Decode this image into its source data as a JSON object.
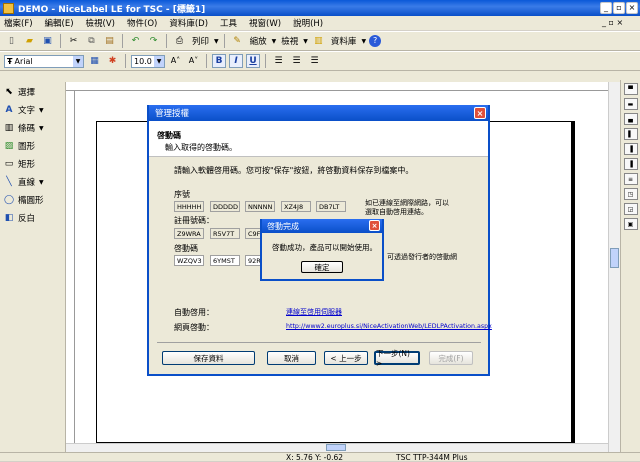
{
  "window": {
    "title": "DEMO - NiceLabel LE for TSC - [標籤1]"
  },
  "menu": [
    "檔案(F)",
    "編輯(E)",
    "檢視(V)",
    "物件(O)",
    "資料庫(D)",
    "工具",
    "視窗(W)",
    "說明(H)"
  ],
  "toolbar1": {
    "print": "列印",
    "zoom": "縮放",
    "check": "檢視",
    "database": "資料庫"
  },
  "toolbar2": {
    "font": "Arial",
    "size": "10.0",
    "bold": "B",
    "italic": "I",
    "underline": "U"
  },
  "tools": [
    {
      "label": "選擇",
      "icon": "pointer-icon"
    },
    {
      "label": "文字",
      "icon": "text-icon"
    },
    {
      "label": "條碼",
      "icon": "barcode-icon"
    },
    {
      "label": "圖形",
      "icon": "picture-icon"
    },
    {
      "label": "矩形",
      "icon": "rectangle-icon"
    },
    {
      "label": "直線",
      "icon": "line-icon"
    },
    {
      "label": "橢圓形",
      "icon": "ellipse-icon"
    },
    {
      "label": "反白",
      "icon": "inverse-icon"
    }
  ],
  "dialog": {
    "title": "管理授權",
    "header_title": "啓動碼",
    "header_sub": "輸入取得的啓動碼。",
    "instruction": "請輸入軟體啓用碼。您可按\"保存\"按鈕，將啓動資料保存到檔案中。",
    "serial_label": "序號",
    "serial": [
      "HHHHH",
      "DDDDD",
      "NNNNN",
      "XZ4J8",
      "DB7LT"
    ],
    "reg_label": "註冊號碼：",
    "reg": [
      "Z9WRA",
      "R5V7T",
      "C9FX"
    ],
    "act_label": "啓動碼",
    "act": [
      "WZQV3",
      "6YMST",
      "92RS"
    ],
    "right_text1": "如已連線至網際網路，可以",
    "right_text2": "選取自動啓用連結。",
    "right_text3": "可透過發行者的啓動網",
    "right_text4": "。",
    "auto_label": "自動啓用：",
    "auto_link": "連線至啓用伺服器",
    "web_label": "網頁啓動：",
    "web_link": "http://www2.europlus.si/NiceActivationWeb/LEDLPActivation.aspx",
    "btn_save": "保存資料",
    "btn_cancel": "取消",
    "btn_prev": "< 上一步",
    "btn_next": "下一步(N) >",
    "btn_finish": "完成(F)"
  },
  "msgbox": {
    "title": "啓動完成",
    "text": "啓動成功，產品可以開始使用。",
    "ok": "確定"
  },
  "status": {
    "coords": "X: 5.76 Y: -0.62",
    "printer": "TSC  TTP-344M Plus"
  }
}
